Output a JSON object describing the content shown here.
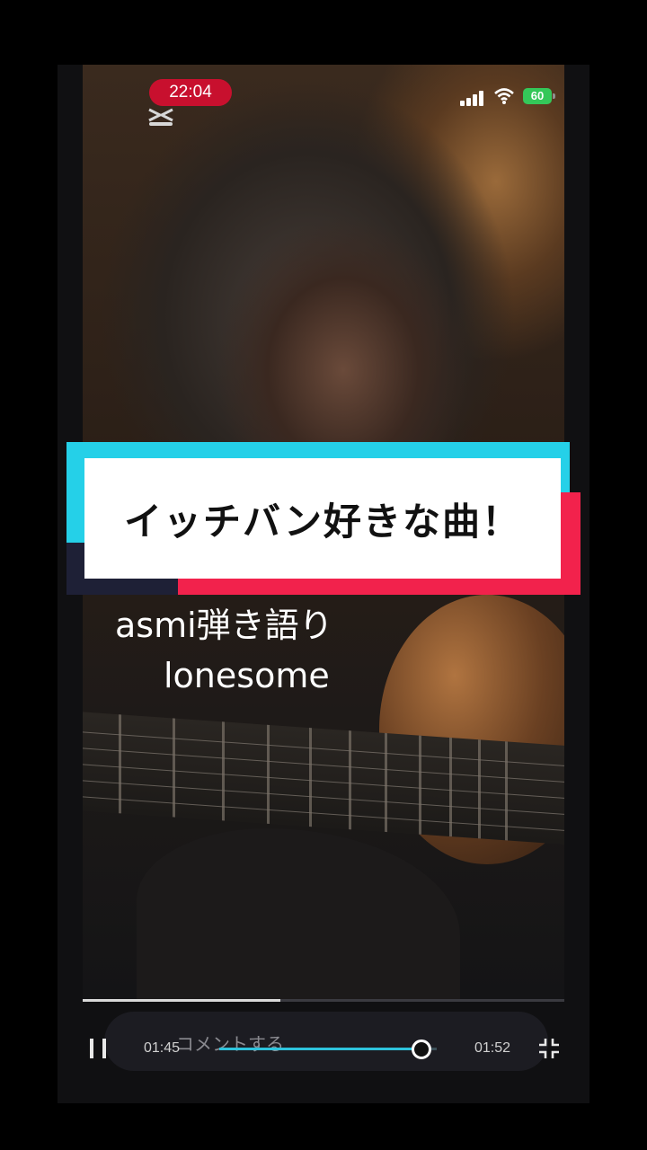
{
  "status_bar": {
    "time": "22:04",
    "battery": "60",
    "app_icon": "capcut-icon",
    "signal_icon": "cellular-signal-icon",
    "wifi_icon": "wifi-icon"
  },
  "banner": {
    "text": "イッチバン好きな曲！",
    "colors": {
      "cyan": "#25d0e8",
      "red": "#f2224c",
      "white": "#ffffff"
    }
  },
  "caption": {
    "line1": "asmi弾き語り",
    "line2": "lonesome"
  },
  "video_progress": 0.41,
  "player": {
    "comment_placeholder": "コメントする...",
    "current_time": "01:45",
    "total_time": "01:52",
    "seek_progress": 0.93,
    "pause_icon": "pause-icon",
    "collapse_icon": "collapse-icon",
    "accent": "#2ec3dc"
  }
}
